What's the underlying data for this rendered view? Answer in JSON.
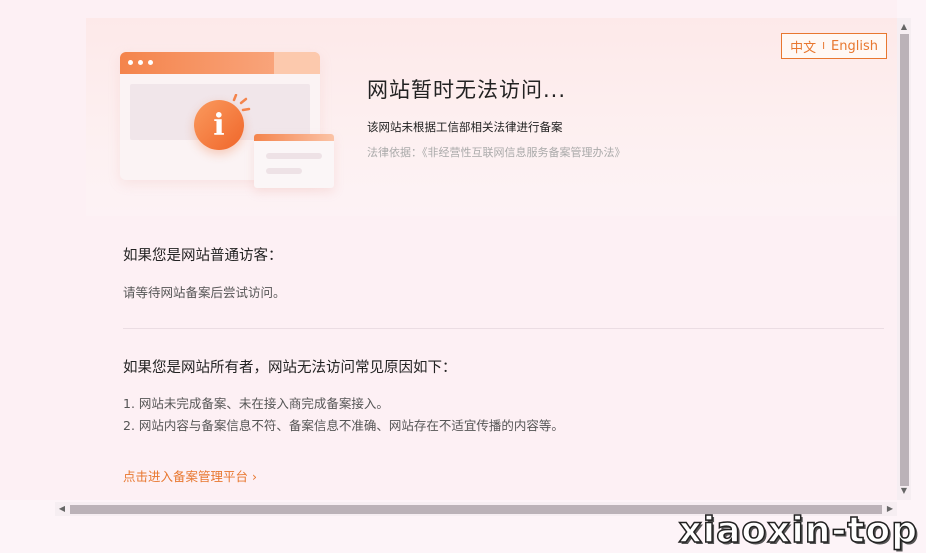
{
  "lang": {
    "zh": "中文",
    "sep": "I",
    "en": "English"
  },
  "hero": {
    "title": "网站暂时无法访问...",
    "subtitle": "该网站未根据工信部相关法律进行备案",
    "law": "法律依据：《非经营性互联网信息服务备案管理办法》"
  },
  "visitor": {
    "title": "如果您是网站普通访客：",
    "text": "请等待网站备案后尝试访问。"
  },
  "owner": {
    "title": "如果您是网站所有者，网站无法访问常见原因如下：",
    "reasons": [
      "1. 网站未完成备案、未在接入商完成备案接入。",
      "2. 网站内容与备案信息不符、备案信息不准确、网站存在不适宜传播的内容等。"
    ]
  },
  "link": "点击进入备案管理平台 ›",
  "watermark": "xiaoxin-top",
  "colors": {
    "accent": "#e8772f",
    "background": "#fdf0f4"
  },
  "icons": {
    "illustration": "info-window-icon",
    "scroll_up": "arrow-up-icon",
    "scroll_down": "arrow-down-icon",
    "scroll_left": "arrow-left-icon",
    "scroll_right": "arrow-right-icon"
  }
}
